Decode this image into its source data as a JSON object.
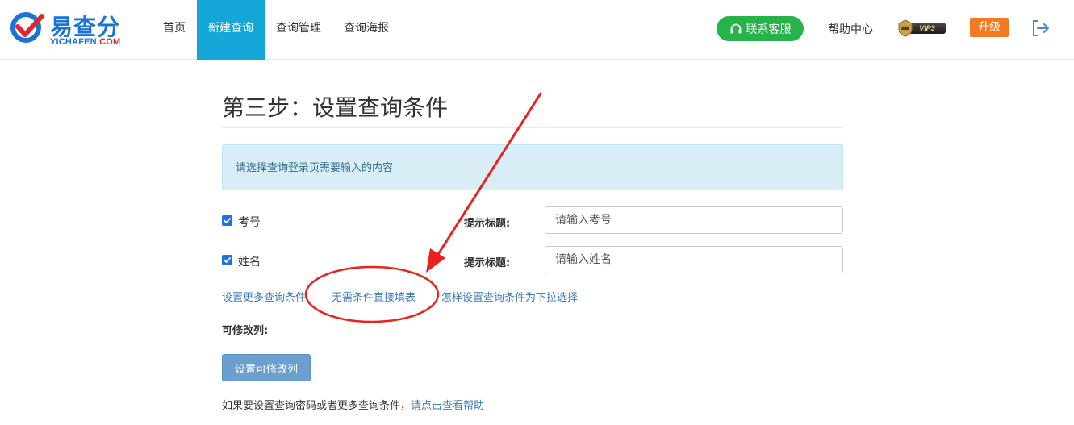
{
  "header": {
    "logo_text": "易查分",
    "logo_sub_left": "YICHAFEN",
    "logo_sub_right": ".COM",
    "nav": [
      {
        "label": "首页",
        "active": false
      },
      {
        "label": "新建查询",
        "active": true
      },
      {
        "label": "查询管理",
        "active": false
      },
      {
        "label": "查询海报",
        "active": false
      }
    ],
    "service_label": "联系客服",
    "help_label": "帮助中心",
    "vip_label": "VIP3",
    "upgrade_label": "升级"
  },
  "main": {
    "title": "第三步：设置查询条件",
    "info": "请选择查询登录页需要输入的内容",
    "conditions": [
      {
        "label": "考号",
        "checked": true,
        "prompt_label": "提示标题:",
        "placeholder": "请输入考号"
      },
      {
        "label": "姓名",
        "checked": true,
        "prompt_label": "提示标题:",
        "placeholder": "请输入姓名"
      }
    ],
    "links": {
      "more_conditions": "设置更多查询条件",
      "no_conditions": "无需条件直接填表",
      "dropdown_howto": "怎样设置查询条件为下拉选择"
    },
    "editable_columns_label": "可修改列:",
    "set_editable_button": "设置可修改列",
    "footnote_text": "如果要设置查询密码或者更多查询条件，",
    "footnote_link": "请点击查看帮助"
  },
  "colors": {
    "accent": "#14a6d6",
    "service_green": "#27b24a",
    "upgrade_orange": "#f47920",
    "link_blue": "#3a7ab8",
    "annotation_red": "#e8221e"
  }
}
